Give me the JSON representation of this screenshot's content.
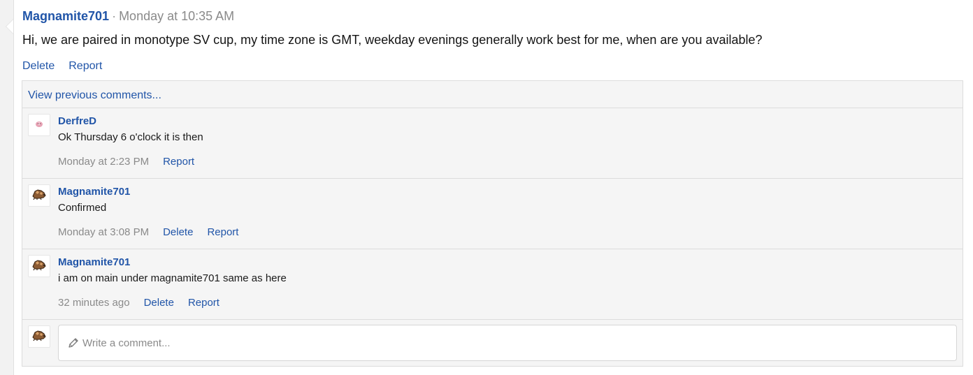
{
  "post": {
    "author": "Magnamite701",
    "separator": "·",
    "time": "Monday at 10:35 AM",
    "body": "Hi, we are paired in monotype SV cup, my time zone is GMT, weekday evenings generally work best for me, when are you available?",
    "actions": {
      "delete": "Delete",
      "report": "Report"
    }
  },
  "comments": {
    "view_previous": "View previous comments...",
    "items": [
      {
        "author": "DerfreD",
        "text": "Ok Thursday 6 o'clock it is then",
        "time": "Monday at 2:23 PM",
        "report": "Report",
        "avatar_icon": "pink-creature-icon"
      },
      {
        "author": "Magnamite701",
        "text": "Confirmed",
        "time": "Monday at 3:08 PM",
        "delete": "Delete",
        "report": "Report",
        "avatar_icon": "brown-creature-icon"
      },
      {
        "author": "Magnamite701",
        "text": "i am on main under magnamite701 same as here",
        "time": "32 minutes ago",
        "delete": "Delete",
        "report": "Report",
        "avatar_icon": "brown-creature-icon"
      }
    ],
    "composer": {
      "placeholder": "Write a comment...",
      "icon": "pencil-icon",
      "avatar_icon": "brown-creature-icon"
    }
  },
  "colors": {
    "link": "#2155a8",
    "muted": "#8a8a8a",
    "comment_bg": "#f5f5f5"
  }
}
